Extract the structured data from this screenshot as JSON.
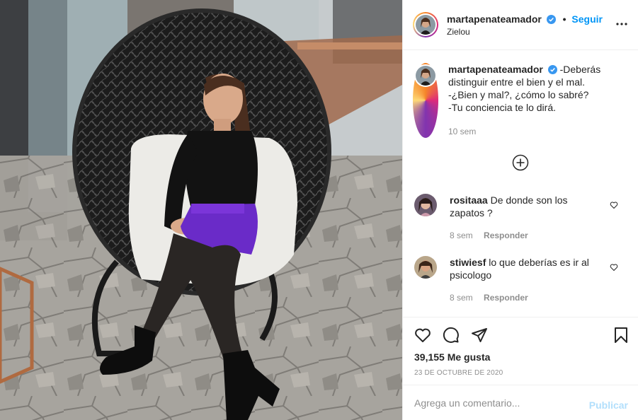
{
  "post": {
    "username": "martapenateamador",
    "follow_label": "Seguir",
    "dot": "•",
    "location": "Zielou",
    "caption_lines": [
      "-Deberás",
      "distinguir entre el bien y el mal.",
      "-¿Bien y mal?, ¿cómo lo sabré?",
      "-Tu conciencia te lo dirá."
    ],
    "caption_time": "10 sem",
    "likes": "39,155 Me gusta",
    "date": "23 DE OCTUBRE DE 2020"
  },
  "comments": [
    {
      "username": "rositaaa",
      "text_lines": [
        "De donde son los",
        "zapatos ?"
      ],
      "time": "8 sem",
      "reply_label": "Responder"
    },
    {
      "username": "stiwiesf",
      "text_lines": [
        "lo que deberías es ir al",
        "psicologo"
      ],
      "time": "8 sem",
      "reply_label": "Responder"
    }
  ],
  "add_comment": {
    "placeholder": "Agrega un comentario...",
    "publish_label": "Publicar"
  },
  "colors": {
    "accent": "#0095f6",
    "publish_disabled": "#b2dffc",
    "muted": "#8e8e8e",
    "text": "#262626",
    "border": "#efefef",
    "verified": "#3897f0"
  },
  "icons": [
    "verified-badge-icon",
    "more-options-icon",
    "load-more-comments-icon",
    "heart-icon",
    "comment-icon",
    "share-icon",
    "save-bookmark-icon"
  ]
}
